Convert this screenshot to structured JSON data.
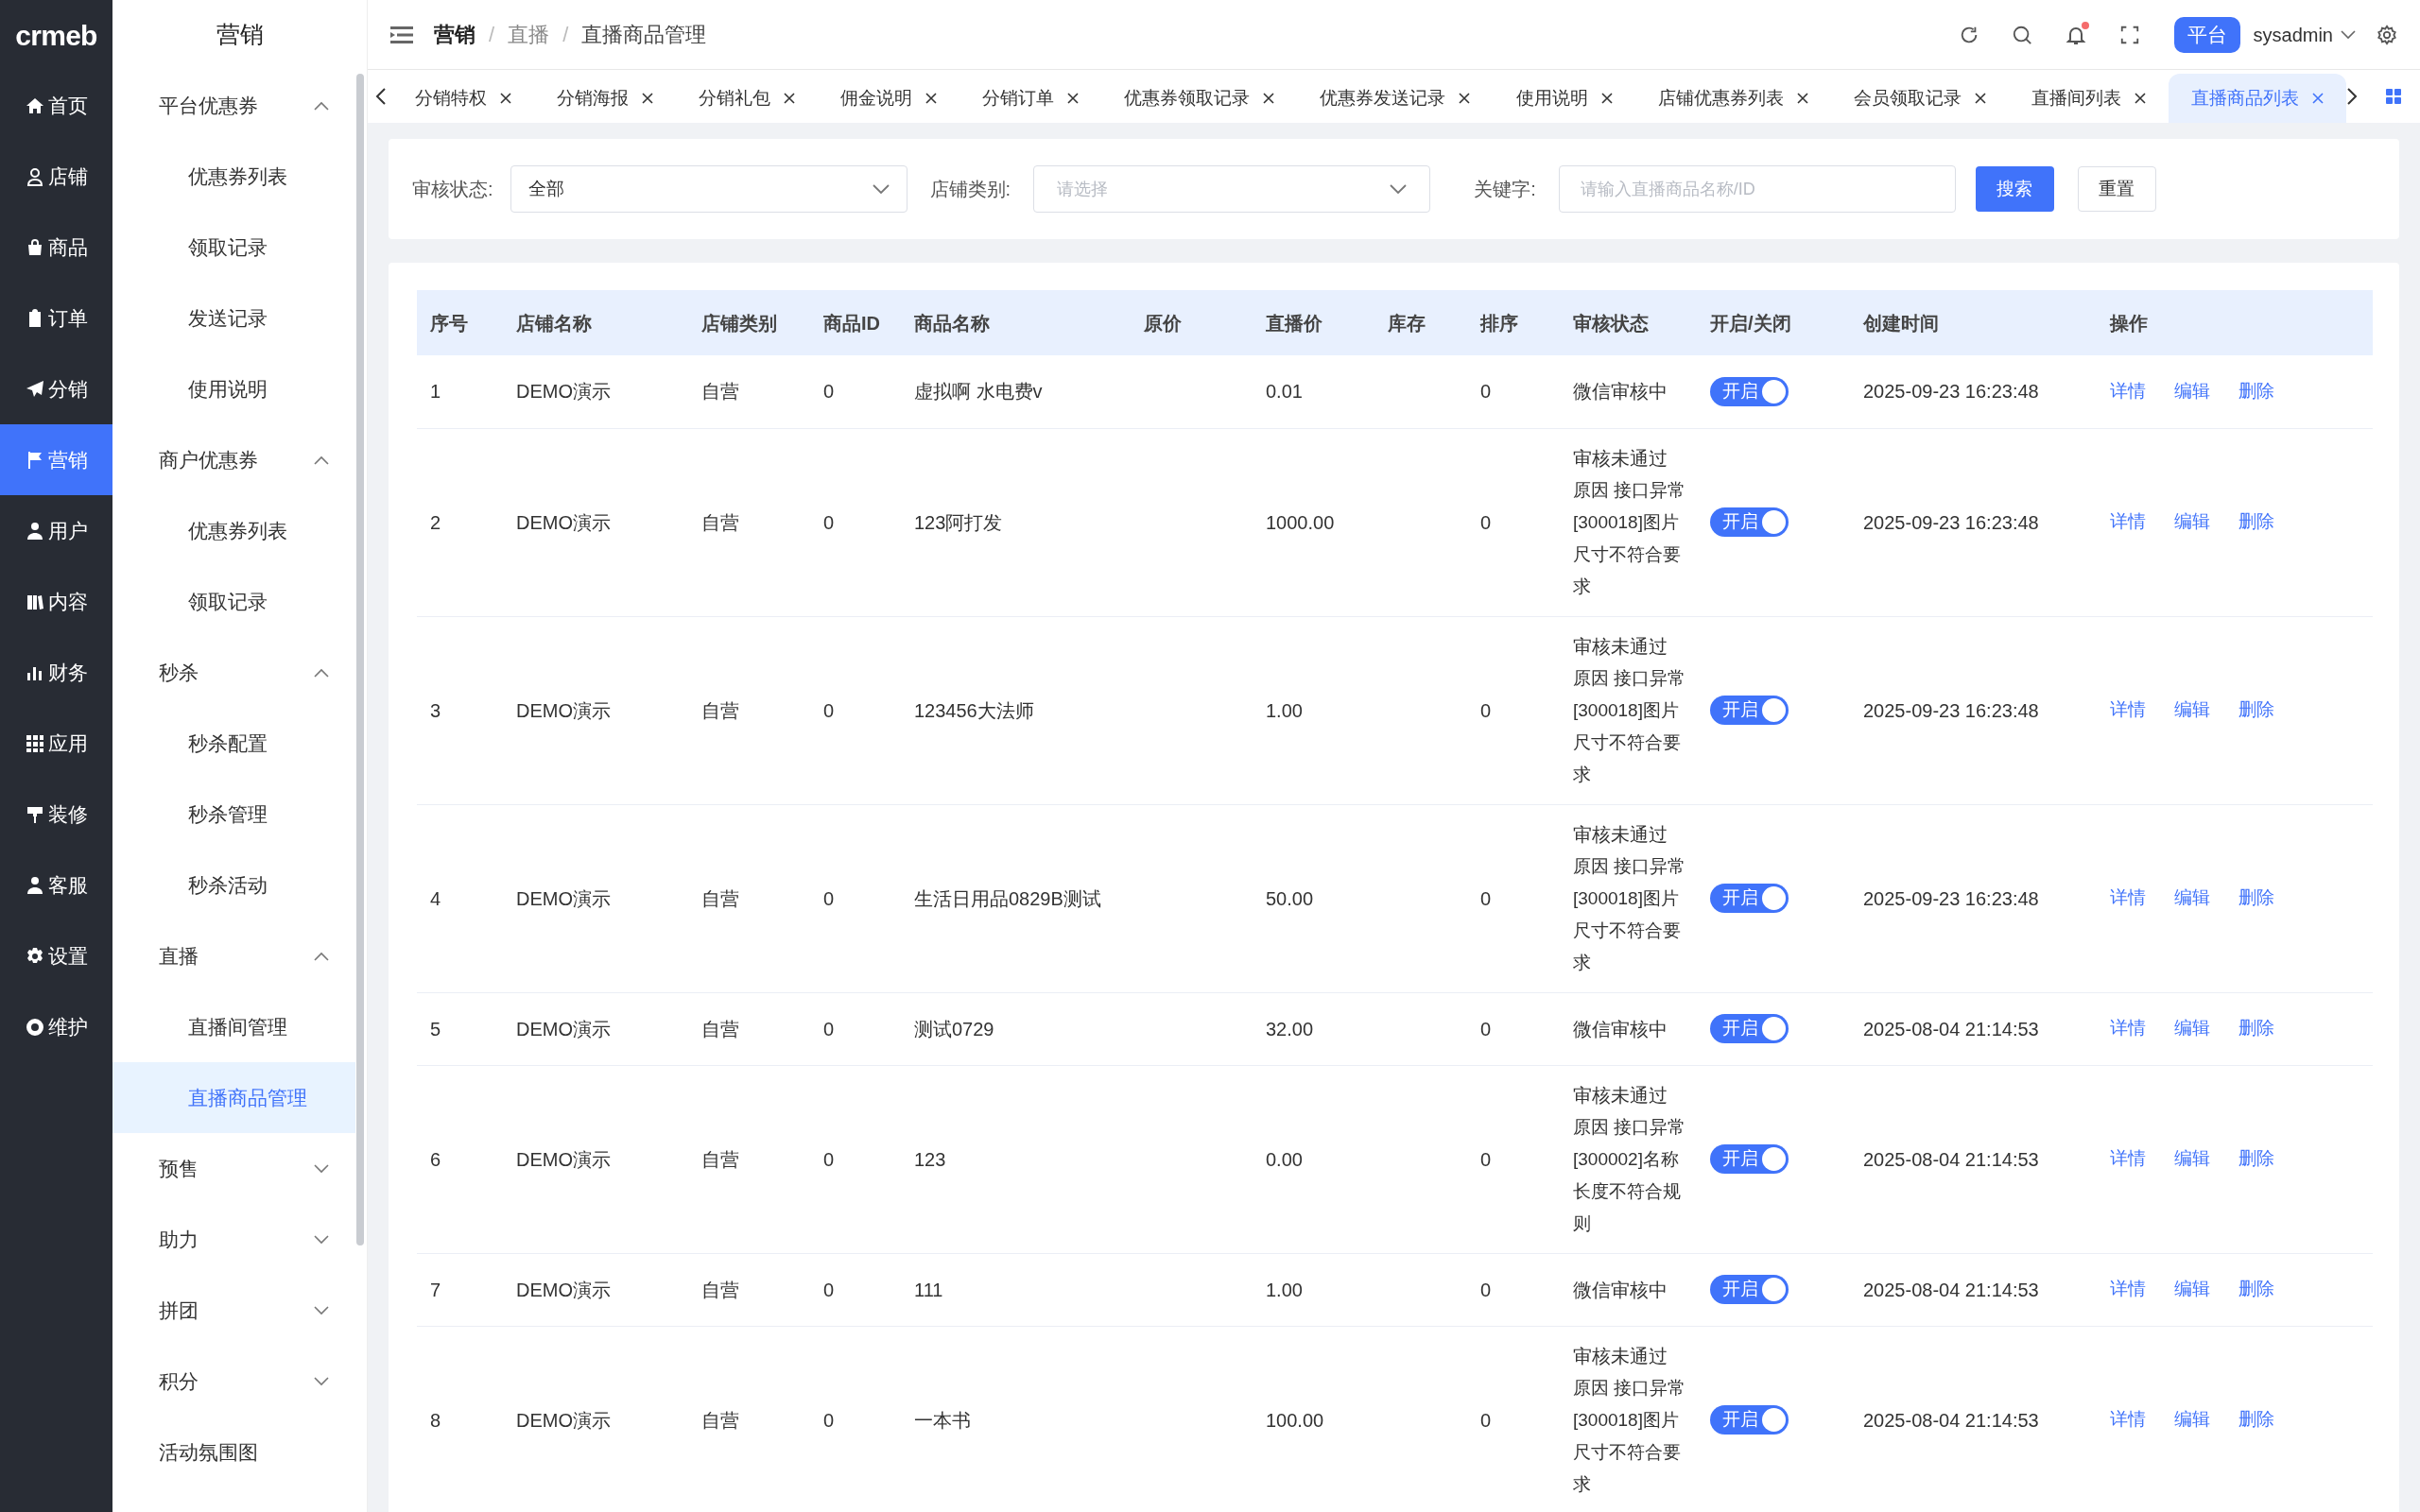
{
  "nav": {
    "logo": "crmeb",
    "items": [
      {
        "label": "首页",
        "selected": false
      },
      {
        "label": "店铺",
        "selected": false
      },
      {
        "label": "商品",
        "selected": false
      },
      {
        "label": "订单",
        "selected": false
      },
      {
        "label": "分销",
        "selected": false
      },
      {
        "label": "营销",
        "selected": true
      },
      {
        "label": "用户",
        "selected": false
      },
      {
        "label": "内容",
        "selected": false
      },
      {
        "label": "财务",
        "selected": false
      },
      {
        "label": "应用",
        "selected": false
      },
      {
        "label": "装修",
        "selected": false
      },
      {
        "label": "客服",
        "selected": false
      },
      {
        "label": "设置",
        "selected": false
      },
      {
        "label": "维护",
        "selected": false
      }
    ]
  },
  "submenu": {
    "title": "营销",
    "items": [
      {
        "kind": "group",
        "label": "平台优惠券",
        "expanded": true,
        "children": [
          {
            "label": "优惠券列表",
            "selected": false
          },
          {
            "label": "领取记录",
            "selected": false
          },
          {
            "label": "发送记录",
            "selected": false
          },
          {
            "label": "使用说明",
            "selected": false
          }
        ]
      },
      {
        "kind": "group",
        "label": "商户优惠券",
        "expanded": true,
        "children": [
          {
            "label": "优惠券列表",
            "selected": false
          },
          {
            "label": "领取记录",
            "selected": false
          }
        ]
      },
      {
        "kind": "group",
        "label": "秒杀",
        "expanded": true,
        "children": [
          {
            "label": "秒杀配置",
            "selected": false
          },
          {
            "label": "秒杀管理",
            "selected": false
          },
          {
            "label": "秒杀活动",
            "selected": false
          }
        ]
      },
      {
        "kind": "group",
        "label": "直播",
        "expanded": true,
        "children": [
          {
            "label": "直播间管理",
            "selected": false
          },
          {
            "label": "直播商品管理",
            "selected": true
          }
        ]
      },
      {
        "kind": "group",
        "label": "预售",
        "expanded": false
      },
      {
        "kind": "group",
        "label": "助力",
        "expanded": false
      },
      {
        "kind": "group",
        "label": "拼团",
        "expanded": false
      },
      {
        "kind": "group",
        "label": "积分",
        "expanded": false
      },
      {
        "kind": "link",
        "label": "活动氛围图",
        "selected": false
      }
    ]
  },
  "header": {
    "breadcrumb": [
      "营销",
      "直播",
      "直播商品管理"
    ],
    "breadcrumb_separator": "/",
    "role_button": "平台",
    "user": "sysadmin",
    "notification_dot": true
  },
  "tabs": [
    {
      "label": "分销特权",
      "selected": false
    },
    {
      "label": "分销海报",
      "selected": false
    },
    {
      "label": "分销礼包",
      "selected": false
    },
    {
      "label": "佣金说明",
      "selected": false
    },
    {
      "label": "分销订单",
      "selected": false
    },
    {
      "label": "优惠券领取记录",
      "selected": false
    },
    {
      "label": "优惠券发送记录",
      "selected": false
    },
    {
      "label": "使用说明",
      "selected": false
    },
    {
      "label": "店铺优惠券列表",
      "selected": false
    },
    {
      "label": "会员领取记录",
      "selected": false
    },
    {
      "label": "直播间列表",
      "selected": false
    },
    {
      "label": "直播商品列表",
      "selected": true
    }
  ],
  "filters": {
    "review_status": {
      "label": "审核状态:",
      "value": "全部"
    },
    "store_type": {
      "label": "店铺类别:",
      "placeholder": "请选择"
    },
    "keyword": {
      "label": "关键字:",
      "placeholder": "请输入直播商品名称/ID"
    },
    "search_button": "搜索",
    "reset_button": "重置"
  },
  "table": {
    "columns": [
      "序号",
      "店铺名称",
      "店铺类别",
      "商品ID",
      "商品名称",
      "原价",
      "直播价",
      "库存",
      "排序",
      "审核状态",
      "开启/关闭",
      "创建时间",
      "操作"
    ],
    "rows": [
      {
        "no": "1",
        "store": "DEMO演示",
        "store_type": "自营",
        "product_id": "0",
        "name": "虚拟啊 水电费v",
        "live_price": "0.01",
        "sort": "0",
        "status": "微信审核中",
        "switch": {
          "on": true,
          "label": "开启"
        },
        "created": "2025-09-23 16:23:48",
        "actions": [
          "详情",
          "编辑",
          "删除"
        ]
      },
      {
        "no": "2",
        "store": "DEMO演示",
        "store_type": "自营",
        "product_id": "0",
        "name": "123阿打发",
        "live_price": "1000.00",
        "sort": "0",
        "status": "审核未通过",
        "reason": "原因 接口异常[300018]图片尺寸不符合要求",
        "switch": {
          "on": true,
          "label": "开启"
        },
        "created": "2025-09-23 16:23:48",
        "actions": [
          "详情",
          "编辑",
          "删除"
        ]
      },
      {
        "no": "3",
        "store": "DEMO演示",
        "store_type": "自营",
        "product_id": "0",
        "name": "123456大法师",
        "live_price": "1.00",
        "sort": "0",
        "status": "审核未通过",
        "reason": "原因 接口异常[300018]图片尺寸不符合要求",
        "switch": {
          "on": true,
          "label": "开启"
        },
        "created": "2025-09-23 16:23:48",
        "actions": [
          "详情",
          "编辑",
          "删除"
        ]
      },
      {
        "no": "4",
        "store": "DEMO演示",
        "store_type": "自营",
        "product_id": "0",
        "name": "生活日用品0829B测试",
        "live_price": "50.00",
        "sort": "0",
        "status": "审核未通过",
        "reason": "原因 接口异常[300018]图片尺寸不符合要求",
        "switch": {
          "on": true,
          "label": "开启"
        },
        "created": "2025-09-23 16:23:48",
        "actions": [
          "详情",
          "编辑",
          "删除"
        ]
      },
      {
        "no": "5",
        "store": "DEMO演示",
        "store_type": "自营",
        "product_id": "0",
        "name": "测试0729",
        "live_price": "32.00",
        "sort": "0",
        "status": "微信审核中",
        "switch": {
          "on": true,
          "label": "开启"
        },
        "created": "2025-08-04 21:14:53",
        "actions": [
          "详情",
          "编辑",
          "删除"
        ]
      },
      {
        "no": "6",
        "store": "DEMO演示",
        "store_type": "自营",
        "product_id": "0",
        "name": "123",
        "live_price": "0.00",
        "sort": "0",
        "status": "审核未通过",
        "reason": "原因 接口异常[300002]名称长度不符合规则",
        "switch": {
          "on": true,
          "label": "开启"
        },
        "created": "2025-08-04 21:14:53",
        "actions": [
          "详情",
          "编辑",
          "删除"
        ]
      },
      {
        "no": "7",
        "store": "DEMO演示",
        "store_type": "自营",
        "product_id": "0",
        "name": "111",
        "live_price": "1.00",
        "sort": "0",
        "status": "微信审核中",
        "switch": {
          "on": true,
          "label": "开启"
        },
        "created": "2025-08-04 21:14:53",
        "actions": [
          "详情",
          "编辑",
          "删除"
        ]
      },
      {
        "no": "8",
        "store": "DEMO演示",
        "store_type": "自营",
        "product_id": "0",
        "name": "一本书",
        "live_price": "100.00",
        "sort": "0",
        "status": "审核未通过",
        "reason": "原因 接口异常[300018]图片尺寸不符合要求",
        "switch": {
          "on": true,
          "label": "开启"
        },
        "created": "2025-08-04 21:14:53",
        "actions": [
          "详情",
          "编辑",
          "删除"
        ]
      }
    ]
  }
}
